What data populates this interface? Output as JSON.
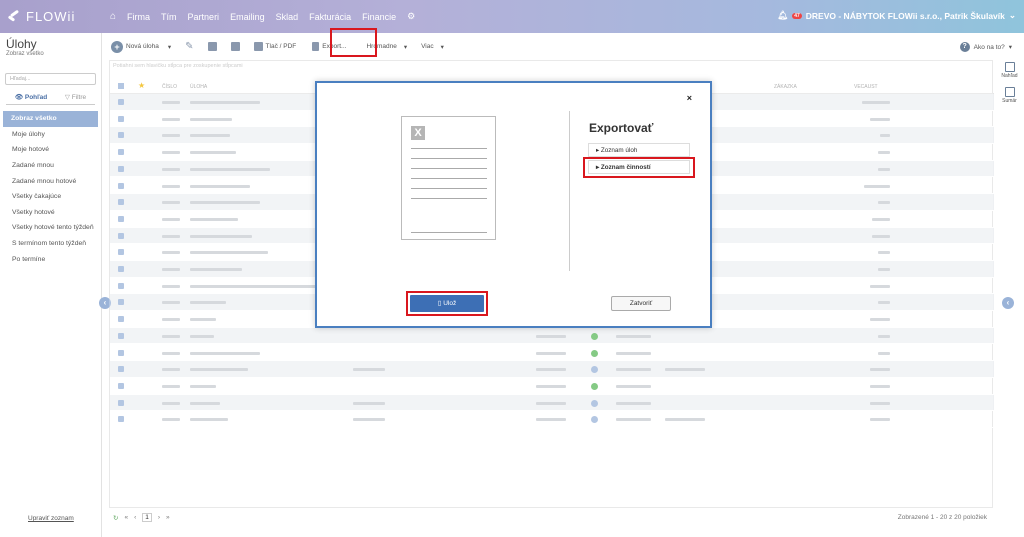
{
  "app": {
    "logo_text": "FLOWii"
  },
  "topnav": {
    "items": [
      "Firma",
      "Tím",
      "Partneri",
      "Emailing",
      "Sklad",
      "Fakturácia",
      "Financie"
    ],
    "badge": "47",
    "account": "DREVO - NÁBYTOK FLOWii s.r.o., Patrik Škulavík"
  },
  "left": {
    "title": "Úlohy",
    "subtitle": "Zobraz všetko",
    "search_placeholder": "Hľadaj...",
    "tab_view": "Pohľad",
    "tab_filter": "Filtre",
    "items": [
      "Zobraz všetko",
      "Moje úlohy",
      "Moje hotové",
      "Zadané mnou",
      "Zadané mnou hotové",
      "Všetky čakajúce",
      "Všetky hotové",
      "Všetky hotové tento týždeň",
      "S termínom tento týždeň",
      "Po termíne"
    ],
    "bottom_link": "Upraviť zoznam"
  },
  "toolbar": {
    "new_task": "Nová úloha",
    "print": "Tlač / PDF",
    "export": "Export...",
    "bulk": "Hromadne",
    "more": "Viac",
    "help": "Ako na to?"
  },
  "grid": {
    "hint": "Potiahni sem hlavičku stĺpca pre zoskupenie stĺpcami",
    "headers": {
      "num": "ČÍSLO",
      "task": "ÚLOHA",
      "order": "ZÁKAZKA",
      "value": "VECAUST"
    }
  },
  "rightbar": {
    "open": "Nahľad",
    "summary": "Sumár"
  },
  "pager": {
    "page": "1",
    "summary": "Zobrazené 1 - 20 z 20 položiek"
  },
  "modal": {
    "title": "Exportovať",
    "options": [
      "Zoznam úloh",
      "Zoznam činností"
    ],
    "save": "Ulož",
    "close": "Zatvoriť",
    "close_x": "×"
  },
  "colors": {
    "accent": "#3d6fb5",
    "highlight": "#d9171e",
    "selected": "#9ab3d8"
  }
}
